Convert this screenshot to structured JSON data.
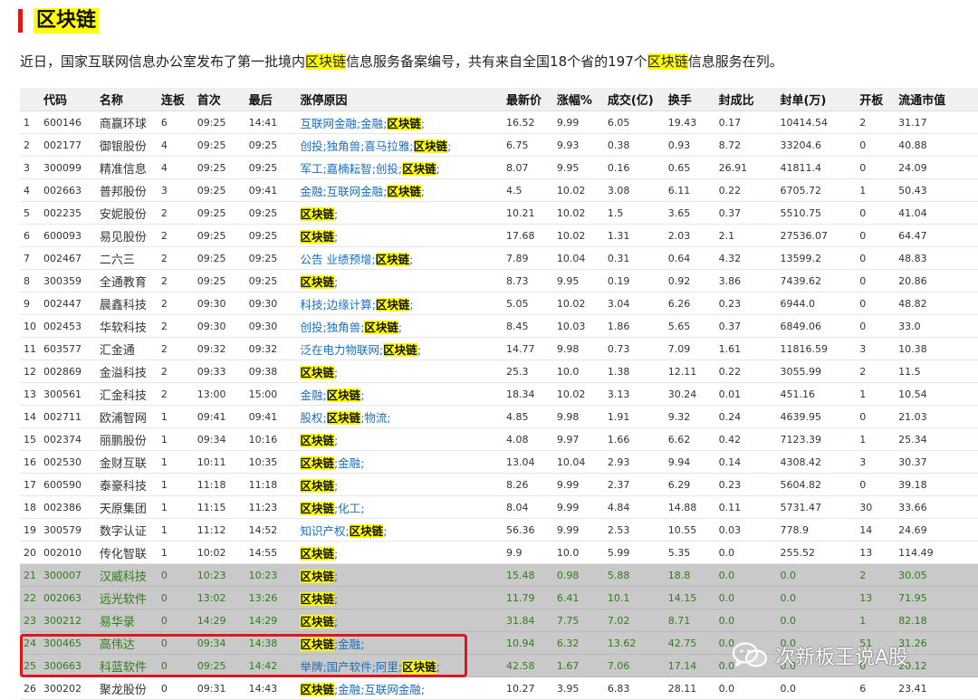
{
  "section": {
    "title": "区块链"
  },
  "intro": {
    "segments": [
      {
        "text": "近日，国家互联网信息办公室发布了第一批境内",
        "highlight": false
      },
      {
        "text": "区块链",
        "highlight": true
      },
      {
        "text": "信息服务备案编号，共有来自全国18个省的197个",
        "highlight": false
      },
      {
        "text": "区块链",
        "highlight": true
      },
      {
        "text": "信息服务在列。",
        "highlight": false
      }
    ]
  },
  "table": {
    "headers": [
      "",
      "代码",
      "名称",
      "连板",
      "首次",
      "最后",
      "涨停原因",
      "最新价",
      "涨幅%",
      "成交(亿)",
      "换手",
      "封成比",
      "封单(万)",
      "开板",
      "流通市值"
    ],
    "rows": [
      {
        "idx": "1",
        "code": "600146",
        "name": "商赢环球",
        "lb": "6",
        "first": "09:25",
        "last": "14:41",
        "reason": [
          "互联网金融",
          "金融",
          "区块链"
        ],
        "price": "16.52",
        "chg": "9.99",
        "amt": "6.05",
        "turnover": "19.43",
        "ratio": "0.17",
        "order": "10414.54",
        "open": "2",
        "cap": "31.17",
        "gray": false
      },
      {
        "idx": "2",
        "code": "002177",
        "name": "御银股份",
        "lb": "4",
        "first": "09:25",
        "last": "09:25",
        "reason": [
          "创投",
          "独角兽",
          "喜马拉雅",
          "区块链"
        ],
        "price": "6.75",
        "chg": "9.93",
        "amt": "0.38",
        "turnover": "0.93",
        "ratio": "8.72",
        "order": "33204.6",
        "open": "0",
        "cap": "40.88",
        "gray": false
      },
      {
        "idx": "3",
        "code": "300099",
        "name": "精准信息",
        "lb": "4",
        "first": "09:25",
        "last": "09:25",
        "reason": [
          "军工",
          "嘉楠耘智",
          "创投",
          "区块链"
        ],
        "price": "8.07",
        "chg": "9.95",
        "amt": "0.16",
        "turnover": "0.65",
        "ratio": "26.91",
        "order": "41811.4",
        "open": "0",
        "cap": "24.09",
        "gray": false
      },
      {
        "idx": "4",
        "code": "002663",
        "name": "普邦股份",
        "lb": "3",
        "first": "09:25",
        "last": "09:41",
        "reason": [
          "金融",
          "互联网金融",
          "区块链"
        ],
        "price": "4.5",
        "chg": "10.02",
        "amt": "3.08",
        "turnover": "6.11",
        "ratio": "0.22",
        "order": "6705.72",
        "open": "1",
        "cap": "50.43",
        "gray": false
      },
      {
        "idx": "5",
        "code": "002235",
        "name": "安妮股份",
        "lb": "2",
        "first": "09:25",
        "last": "09:25",
        "reason": [
          "区块链"
        ],
        "price": "10.21",
        "chg": "10.02",
        "amt": "1.5",
        "turnover": "3.65",
        "ratio": "0.37",
        "order": "5510.75",
        "open": "0",
        "cap": "41.04",
        "gray": false
      },
      {
        "idx": "6",
        "code": "600093",
        "name": "易见股份",
        "lb": "2",
        "first": "09:25",
        "last": "09:25",
        "reason": [
          "区块链"
        ],
        "price": "17.68",
        "chg": "10.02",
        "amt": "1.31",
        "turnover": "2.03",
        "ratio": "2.1",
        "order": "27536.07",
        "open": "0",
        "cap": "64.47",
        "gray": false
      },
      {
        "idx": "7",
        "code": "002467",
        "name": "二六三",
        "lb": "2",
        "first": "09:25",
        "last": "09:25",
        "reason": [
          "公告 业绩预增",
          "区块链"
        ],
        "price": "7.89",
        "chg": "10.04",
        "amt": "0.31",
        "turnover": "0.64",
        "ratio": "4.32",
        "order": "13599.2",
        "open": "0",
        "cap": "48.83",
        "gray": false
      },
      {
        "idx": "8",
        "code": "300359",
        "name": "全通教育",
        "lb": "2",
        "first": "09:25",
        "last": "09:25",
        "reason": [
          "区块链"
        ],
        "price": "8.73",
        "chg": "9.95",
        "amt": "0.19",
        "turnover": "0.92",
        "ratio": "3.86",
        "order": "7439.62",
        "open": "0",
        "cap": "20.86",
        "gray": false
      },
      {
        "idx": "9",
        "code": "002447",
        "name": "晨鑫科技",
        "lb": "2",
        "first": "09:30",
        "last": "09:30",
        "reason": [
          "科技",
          "边缘计算",
          "区块链"
        ],
        "price": "5.05",
        "chg": "10.02",
        "amt": "3.04",
        "turnover": "6.26",
        "ratio": "0.23",
        "order": "6944.0",
        "open": "0",
        "cap": "48.82",
        "gray": false
      },
      {
        "idx": "10",
        "code": "002453",
        "name": "华软科技",
        "lb": "2",
        "first": "09:30",
        "last": "09:30",
        "reason": [
          "创投",
          "独角兽",
          "区块链"
        ],
        "price": "8.45",
        "chg": "10.03",
        "amt": "1.86",
        "turnover": "5.65",
        "ratio": "0.37",
        "order": "6849.06",
        "open": "0",
        "cap": "33.0",
        "gray": false
      },
      {
        "idx": "11",
        "code": "603577",
        "name": "汇金通",
        "lb": "2",
        "first": "09:32",
        "last": "09:32",
        "reason": [
          "泛在电力物联网",
          "区块链"
        ],
        "price": "14.77",
        "chg": "9.98",
        "amt": "0.73",
        "turnover": "7.09",
        "ratio": "1.61",
        "order": "11816.59",
        "open": "3",
        "cap": "10.38",
        "gray": false
      },
      {
        "idx": "12",
        "code": "002869",
        "name": "金溢科技",
        "lb": "2",
        "first": "09:33",
        "last": "09:38",
        "reason": [
          "区块链"
        ],
        "price": "25.3",
        "chg": "10.0",
        "amt": "1.38",
        "turnover": "12.11",
        "ratio": "0.22",
        "order": "3055.99",
        "open": "2",
        "cap": "11.5",
        "gray": false
      },
      {
        "idx": "13",
        "code": "300561",
        "name": "汇金科技",
        "lb": "2",
        "first": "13:00",
        "last": "15:00",
        "reason": [
          "金融",
          "区块链"
        ],
        "price": "18.34",
        "chg": "10.02",
        "amt": "3.13",
        "turnover": "30.24",
        "ratio": "0.01",
        "order": "451.16",
        "open": "1",
        "cap": "10.54",
        "gray": false
      },
      {
        "idx": "14",
        "code": "002711",
        "name": "欧浦智网",
        "lb": "1",
        "first": "09:41",
        "last": "09:41",
        "reason": [
          "股权",
          "区块链",
          "物流"
        ],
        "price": "4.85",
        "chg": "9.98",
        "amt": "1.91",
        "turnover": "9.32",
        "ratio": "0.24",
        "order": "4639.95",
        "open": "0",
        "cap": "21.03",
        "gray": false
      },
      {
        "idx": "15",
        "code": "002374",
        "name": "丽鹏股份",
        "lb": "1",
        "first": "09:34",
        "last": "10:16",
        "reason": [
          "区块链"
        ],
        "price": "4.08",
        "chg": "9.97",
        "amt": "1.66",
        "turnover": "6.62",
        "ratio": "0.42",
        "order": "7123.39",
        "open": "1",
        "cap": "25.34",
        "gray": false
      },
      {
        "idx": "16",
        "code": "002530",
        "name": "金财互联",
        "lb": "1",
        "first": "10:11",
        "last": "10:35",
        "reason": [
          "区块链",
          "金融"
        ],
        "price": "13.04",
        "chg": "10.04",
        "amt": "2.93",
        "turnover": "9.94",
        "ratio": "0.14",
        "order": "4308.42",
        "open": "3",
        "cap": "30.37",
        "gray": false
      },
      {
        "idx": "17",
        "code": "600590",
        "name": "泰豪科技",
        "lb": "1",
        "first": "11:18",
        "last": "11:18",
        "reason": [
          "区块链"
        ],
        "price": "8.26",
        "chg": "9.99",
        "amt": "2.37",
        "turnover": "6.29",
        "ratio": "0.23",
        "order": "5604.82",
        "open": "0",
        "cap": "39.18",
        "gray": false
      },
      {
        "idx": "18",
        "code": "002386",
        "name": "天原集团",
        "lb": "1",
        "first": "11:15",
        "last": "11:23",
        "reason": [
          "区块链",
          "化工"
        ],
        "price": "8.04",
        "chg": "9.99",
        "amt": "4.84",
        "turnover": "14.88",
        "ratio": "0.11",
        "order": "5731.47",
        "open": "30",
        "cap": "33.66",
        "gray": false
      },
      {
        "idx": "19",
        "code": "300579",
        "name": "数字认证",
        "lb": "1",
        "first": "11:12",
        "last": "14:52",
        "reason": [
          "知识产权",
          "区块链"
        ],
        "price": "56.36",
        "chg": "9.99",
        "amt": "2.53",
        "turnover": "10.55",
        "ratio": "0.03",
        "order": "778.9",
        "open": "14",
        "cap": "24.69",
        "gray": false
      },
      {
        "idx": "20",
        "code": "002010",
        "name": "传化智联",
        "lb": "1",
        "first": "10:02",
        "last": "14:55",
        "reason": [
          "区块链"
        ],
        "price": "9.9",
        "chg": "10.0",
        "amt": "5.99",
        "turnover": "5.35",
        "ratio": "0.0",
        "order": "255.52",
        "open": "13",
        "cap": "114.49",
        "gray": false
      },
      {
        "idx": "21",
        "code": "300007",
        "name": "汉威科技",
        "lb": "0",
        "first": "10:23",
        "last": "10:23",
        "reason": [
          "区块链"
        ],
        "price": "15.48",
        "chg": "0.98",
        "amt": "5.88",
        "turnover": "18.8",
        "ratio": "0.0",
        "order": "0.0",
        "open": "2",
        "cap": "30.05",
        "gray": true
      },
      {
        "idx": "22",
        "code": "002063",
        "name": "远光软件",
        "lb": "0",
        "first": "13:02",
        "last": "13:26",
        "reason": [
          "区块链"
        ],
        "price": "11.79",
        "chg": "6.41",
        "amt": "10.1",
        "turnover": "14.15",
        "ratio": "0.0",
        "order": "0.0",
        "open": "13",
        "cap": "71.95",
        "gray": true
      },
      {
        "idx": "23",
        "code": "300212",
        "name": "易华录",
        "lb": "0",
        "first": "14:29",
        "last": "14:29",
        "reason": [
          "区块链"
        ],
        "price": "31.84",
        "chg": "7.75",
        "amt": "7.02",
        "turnover": "8.71",
        "ratio": "0.0",
        "order": "0.0",
        "open": "1",
        "cap": "82.18",
        "gray": true
      },
      {
        "idx": "24",
        "code": "300465",
        "name": "高伟达",
        "lb": "0",
        "first": "09:34",
        "last": "14:38",
        "reason": [
          "区块链",
          "金融"
        ],
        "price": "10.94",
        "chg": "6.32",
        "amt": "13.62",
        "turnover": "42.75",
        "ratio": "0.0",
        "order": "0.0",
        "open": "51",
        "cap": "31.26",
        "gray": true
      },
      {
        "idx": "25",
        "code": "300663",
        "name": "科蓝软件",
        "lb": "0",
        "first": "09:25",
        "last": "14:42",
        "reason": [
          "举牌",
          "国产软件",
          "阿里",
          "区块链"
        ],
        "price": "42.58",
        "chg": "1.67",
        "amt": "7.06",
        "turnover": "17.14",
        "ratio": "0.0",
        "order": "0.0",
        "open": "0",
        "cap": "20.12",
        "gray": true
      },
      {
        "idx": "26",
        "code": "300202",
        "name": "聚龙股份",
        "lb": "0",
        "first": "09:31",
        "last": "14:43",
        "reason": [
          "区块链",
          "金融",
          "互联网金融"
        ],
        "price": "10.27",
        "chg": "3.95",
        "amt": "6.83",
        "turnover": "28.11",
        "ratio": "0.0",
        "order": "0.0",
        "open": "6",
        "cap": "23.41",
        "gray": false
      }
    ],
    "highlight_tag": "区块链"
  },
  "watermark": {
    "text": "次新板王说A股",
    "icon": "wechat-icon"
  },
  "colors": {
    "accent_bar": "#e0161b",
    "highlight": "#ffff00",
    "link_blue": "#1a6fc0",
    "gray_row_bg": "#c9c9c9",
    "gray_row_text": "#2e7d1a",
    "red_box": "#e3141b"
  }
}
